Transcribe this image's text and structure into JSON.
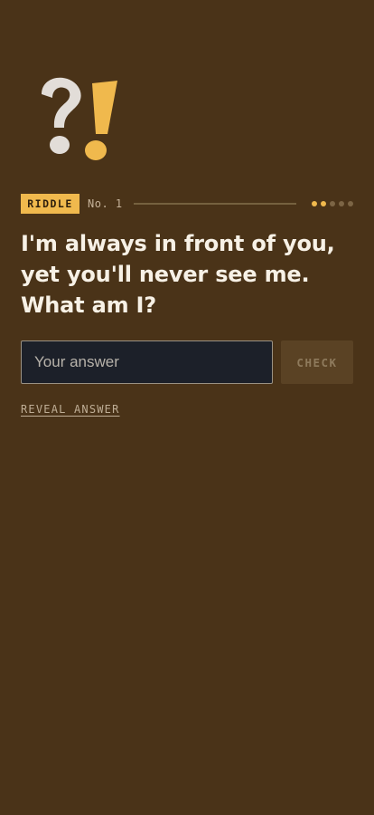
{
  "riddle": {
    "tag_label": "RIDDLE",
    "number_label": "No. 1",
    "question": "I'm always in front of you, yet you'll never see me. What am I?",
    "progress": {
      "current": 2,
      "total": 5
    }
  },
  "answer_form": {
    "input_value": "",
    "input_placeholder": "Your answer",
    "check_label": "CHECK",
    "reveal_label": "REVEAL ANSWER"
  },
  "colors": {
    "background": "#4a3318",
    "accent": "#f0b94d",
    "question_mark": "#e2ddd8",
    "input_background": "#1c2029"
  },
  "icons": {
    "logo": "question-exclamation-icon"
  }
}
